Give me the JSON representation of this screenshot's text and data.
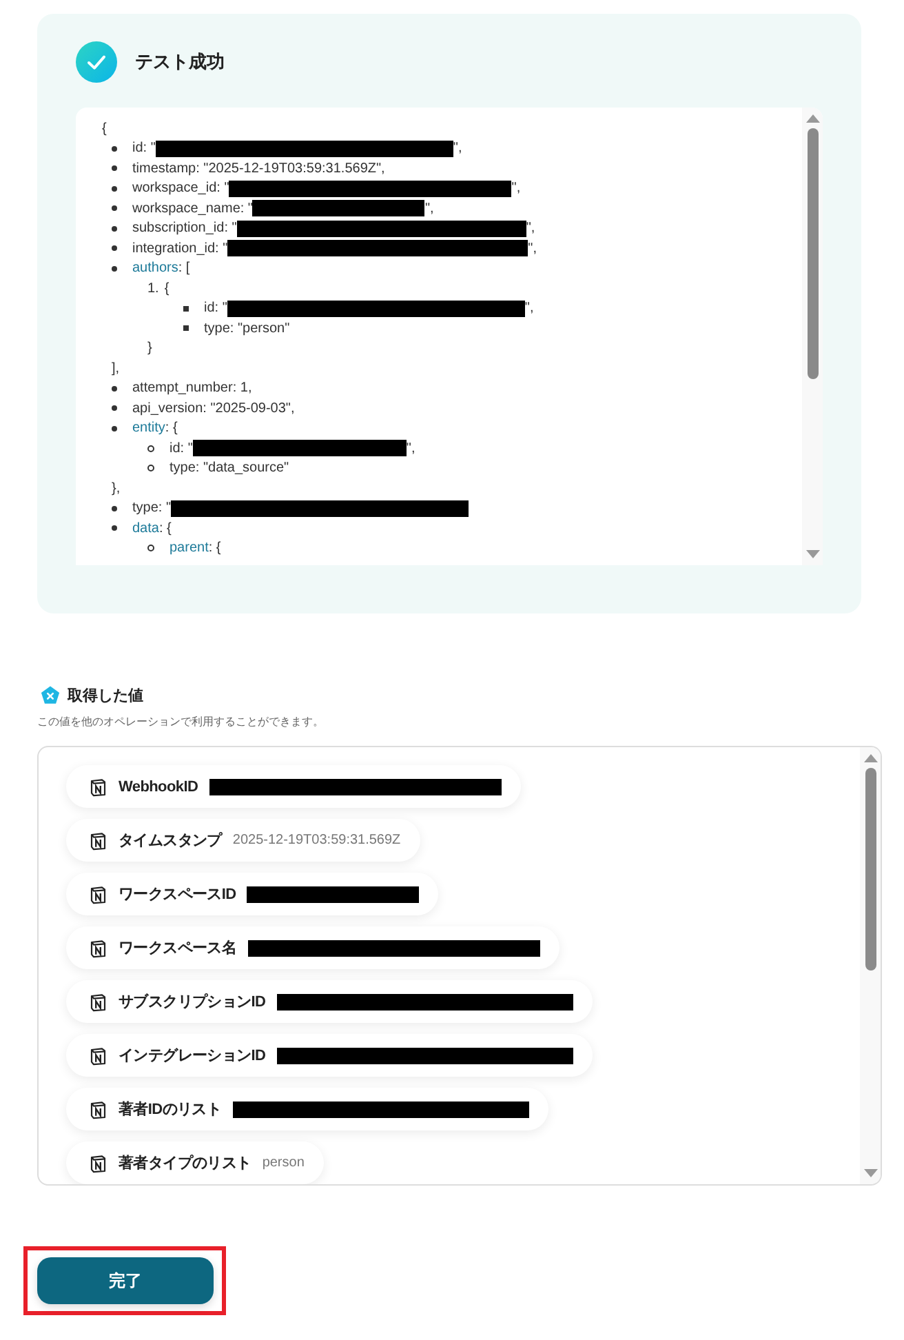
{
  "test_result": {
    "title": "テスト成功",
    "json_view": {
      "open": "{",
      "items": [
        {
          "key": "id",
          "value": ": \"",
          "redacted": true,
          "tail": "\","
        },
        {
          "key": "timestamp",
          "value": ": \"2025-12-19T03:59:31.569Z\","
        },
        {
          "key": "workspace_id",
          "value": ": \"",
          "redacted": true,
          "tail": "\","
        },
        {
          "key": "workspace_name",
          "value": ": \"",
          "redacted": true,
          "tail": "\","
        },
        {
          "key": "subscription_id",
          "value": ": \"",
          "redacted": true,
          "tail": "\","
        },
        {
          "key": "integration_id",
          "value": ": \"",
          "redacted": true,
          "tail": "\","
        },
        {
          "key": "authors",
          "expandable": true,
          "value": ": [",
          "close": "],",
          "children": [
            {
              "marker": "1.",
              "value": "{",
              "close": "}",
              "children": [
                {
                  "key": "id",
                  "value": ": \"",
                  "redacted": true,
                  "tail": "\","
                },
                {
                  "key": "type",
                  "value": ": \"person\""
                }
              ]
            }
          ]
        },
        {
          "key": "attempt_number",
          "value": ": 1,"
        },
        {
          "key": "api_version",
          "value": ": \"2025-09-03\","
        },
        {
          "key": "entity",
          "expandable": true,
          "value": ": {",
          "close": "},",
          "children": [
            {
              "key": "id",
              "value": ": \"",
              "redacted": true,
              "tail": "\","
            },
            {
              "key": "type",
              "value": ": \"data_source\""
            }
          ]
        },
        {
          "key": "type",
          "value": ": \"",
          "redacted": true
        },
        {
          "key": "data",
          "expandable": true,
          "value": ": {",
          "children": [
            {
              "key": "parent",
              "expandable": true,
              "value": ": {"
            }
          ]
        }
      ]
    }
  },
  "values_section": {
    "title": "取得した値",
    "description": "この値を他のオペレーションで利用することができます。",
    "items": [
      {
        "label": "WebhookID",
        "redacted": true
      },
      {
        "label": "タイムスタンプ",
        "value": "2025-12-19T03:59:31.569Z"
      },
      {
        "label": "ワークスペースID",
        "redacted": true
      },
      {
        "label": "ワークスペース名",
        "redacted": true
      },
      {
        "label": "サブスクリプションID",
        "redacted": true
      },
      {
        "label": "インテグレーションID",
        "redacted": true
      },
      {
        "label": "著者IDのリスト",
        "redacted": true
      },
      {
        "label": "著者タイプのリスト",
        "value": "person"
      }
    ]
  },
  "done_button": {
    "label": "完了",
    "highlighted": true
  }
}
